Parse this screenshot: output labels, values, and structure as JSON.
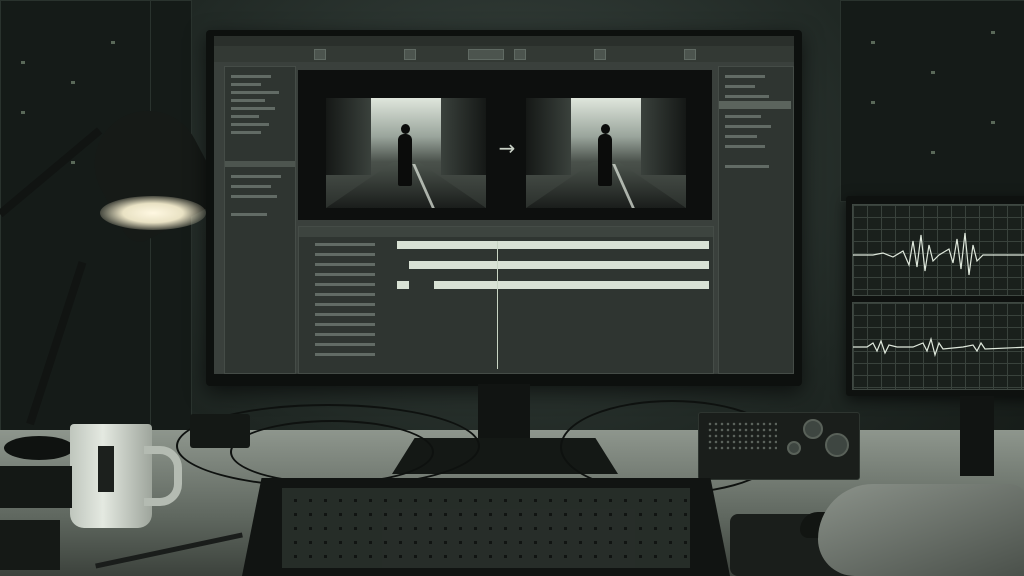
{
  "scene": {
    "description_type": "photo of editing desk",
    "colors": {
      "ambient": "#1f2622",
      "screen_ui": "#3a403c",
      "clip": "#d9e2d5",
      "lamp_light": "#fff8e2"
    }
  },
  "editor": {
    "icons": [
      "play-icon",
      "arrow-right-icon",
      "folder-icon"
    ],
    "transition_arrow": "→"
  },
  "tracks": {
    "clips": [
      {
        "track": 1,
        "start": 0.0,
        "end": 1.0
      },
      {
        "track": 2,
        "start": 0.04,
        "end": 1.0
      },
      {
        "track": 3,
        "start": 0.0,
        "end": 0.04
      },
      {
        "track": 3,
        "start": 0.12,
        "end": 1.0
      }
    ],
    "playhead_pos": 0.32
  }
}
